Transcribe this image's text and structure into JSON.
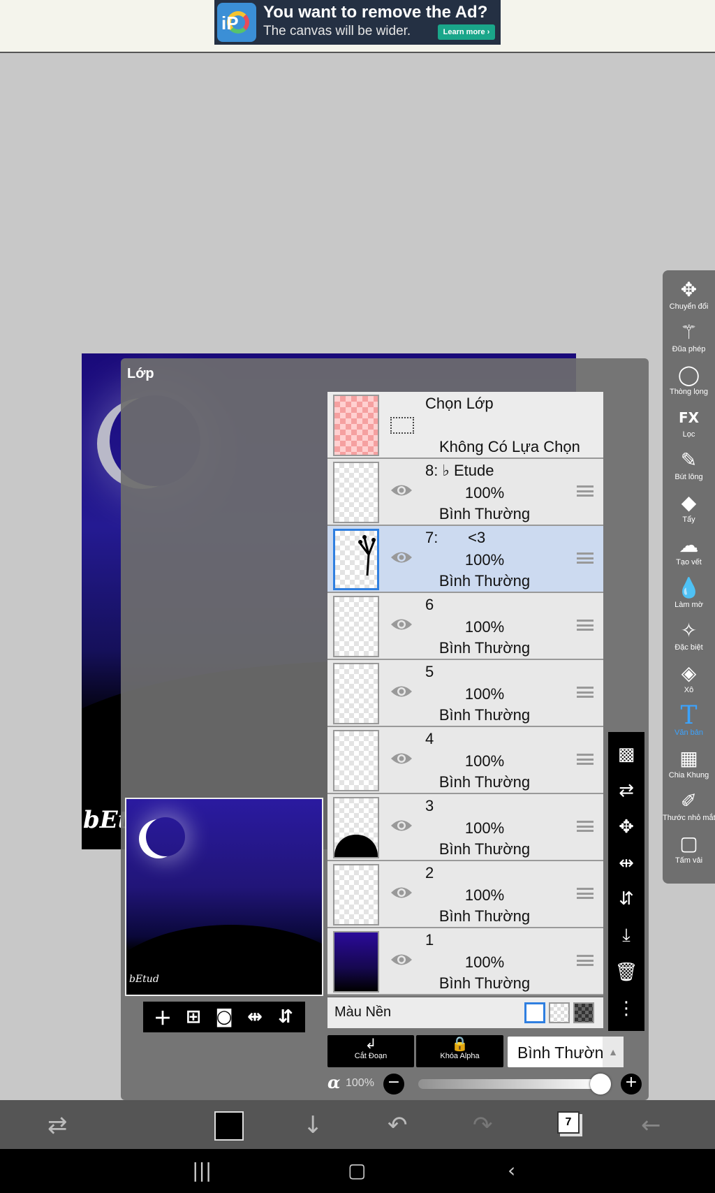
{
  "ad": {
    "title": "You want to remove the Ad?",
    "subtitle": "The canvas will be wider.",
    "button": "Learn more ›"
  },
  "panel": {
    "title": "Lớp",
    "selection": {
      "label": "Chọn Lớp",
      "value": "Không Có Lựa Chọn"
    },
    "layers": [
      {
        "name": "8: ♭ Etude",
        "opacity": "100%",
        "mode": "Bình Thường",
        "selected": false
      },
      {
        "name": "7:       <3",
        "opacity": "100%",
        "mode": "Bình Thường",
        "selected": true
      },
      {
        "name": "6",
        "opacity": "100%",
        "mode": "Bình Thường",
        "selected": false
      },
      {
        "name": "5",
        "opacity": "100%",
        "mode": "Bình Thường",
        "selected": false
      },
      {
        "name": "4",
        "opacity": "100%",
        "mode": "Bình Thường",
        "selected": false
      },
      {
        "name": "3",
        "opacity": "100%",
        "mode": "Bình Thường",
        "selected": false
      },
      {
        "name": "2",
        "opacity": "100%",
        "mode": "Bình Thường",
        "selected": false
      },
      {
        "name": "1",
        "opacity": "100%",
        "mode": "Bình Thường",
        "selected": false
      }
    ],
    "background_label": "Màu Nền",
    "clip_label": "Cắt Đoạn",
    "alpha_lock_label": "Khóa Alpha",
    "blend_mode": "Bình Thường",
    "alpha_symbol": "α",
    "alpha_value": "100%",
    "alpha_fraction": 1.0
  },
  "preview_toolbar": [
    "add-layer",
    "add-image-layer",
    "camera",
    "flip-horizontal",
    "flip-vertical"
  ],
  "tools": [
    {
      "label": "Chuyển đổi",
      "icon": "move-icon",
      "glyph": "✥"
    },
    {
      "label": "Đũa phép",
      "icon": "magic-wand-icon",
      "glyph": "⚚"
    },
    {
      "label": "Thòng lọng",
      "icon": "lasso-icon",
      "glyph": "◯"
    },
    {
      "label": "Lọc",
      "icon": "fx-icon",
      "glyph": "FX"
    },
    {
      "label": "Bút lông",
      "icon": "brush-icon",
      "glyph": "✎"
    },
    {
      "label": "Tẩy",
      "icon": "eraser-icon",
      "glyph": "◆"
    },
    {
      "label": "Tạo vết",
      "icon": "smudge-icon",
      "glyph": "☁"
    },
    {
      "label": "Làm mờ",
      "icon": "blur-icon",
      "glyph": "💧"
    },
    {
      "label": "Đặc biệt",
      "icon": "special-brush-icon",
      "glyph": "✧"
    },
    {
      "label": "Xô",
      "icon": "bucket-icon",
      "glyph": "◈"
    },
    {
      "label": "Văn bản",
      "icon": "text-icon",
      "glyph": "T",
      "active": true
    },
    {
      "label": "Chia Khung",
      "icon": "frame-divider-icon",
      "glyph": "▦"
    },
    {
      "label": "Thước nhỏ mắt",
      "icon": "eyedropper-icon",
      "glyph": "✐"
    },
    {
      "label": "Tấm vải",
      "icon": "canvas-icon",
      "glyph": "▢"
    }
  ],
  "bottom": {
    "layer_count": "7",
    "brush_color": "#000000"
  },
  "colors": {
    "accent": "#2f7fe0",
    "active_tool": "#3ba3ff",
    "selected_row": "#ccdaf0"
  }
}
